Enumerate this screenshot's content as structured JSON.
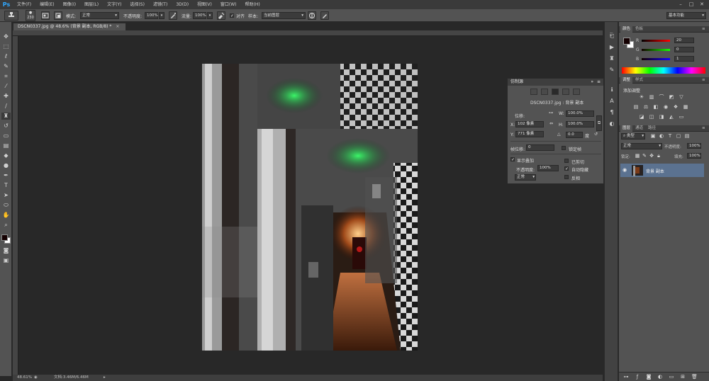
{
  "app": {
    "logo": "Ps"
  },
  "menubar": {
    "items": [
      "文件(F)",
      "编辑(E)",
      "图像(I)",
      "图层(L)",
      "文字(Y)",
      "选择(S)",
      "滤镜(T)",
      "3D(D)",
      "视图(V)",
      "窗口(W)",
      "帮助(H)"
    ],
    "window_controls": [
      "minimize-icon",
      "maximize-icon",
      "close-icon"
    ]
  },
  "options": {
    "brush_size": "230",
    "mode_label": "模式:",
    "mode_value": "正常",
    "opacity_label": "不透明度:",
    "opacity_value": "100%",
    "flow_label": "流量:",
    "flow_value": "100%",
    "align_label": "对齐",
    "sample_label": "样本:",
    "sample_value": "当前图层",
    "workspace": "基本功能"
  },
  "document": {
    "tab_title": "DSCN0337.jpg @ 48.6% (背景 副本, RGB/8) *",
    "zoom": "48.61%",
    "doc_info": "文档:3.46M/6.46M"
  },
  "clone_source": {
    "title": "仿制源",
    "source_name": "DSCN0337.jpg : 背景 副本",
    "offset_label": "位移:",
    "x_label": "X:",
    "x_value": "102 像素",
    "y_label": "Y:",
    "y_value": "771 像素",
    "w_label": "W:",
    "w_value": "100.0%",
    "h_label": "H:",
    "h_value": "100.0%",
    "angle_value": "0.0",
    "angle_unit": "度",
    "frame_offset_label": "帧位移:",
    "frame_offset_value": "0",
    "lock_frame_label": "锁定帧",
    "show_overlay_label": "显示叠加",
    "show_overlay_checked": true,
    "opacity_label": "不透明度:",
    "opacity_value": "100%",
    "clipped_label": "已剪切",
    "clipped_checked": false,
    "auto_hide_label": "自动隐藏",
    "auto_hide_checked": true,
    "invert_label": "反相",
    "invert_checked": false,
    "blend_value": "正常"
  },
  "color_panel": {
    "tabs": [
      "颜色",
      "色板"
    ],
    "r_label": "R",
    "r_value": "20",
    "g_label": "G",
    "g_value": "0",
    "b_label": "B",
    "b_value": "1",
    "foreground": "#140001",
    "background": "#ffffff"
  },
  "adjustments_panel": {
    "tabs": [
      "调整",
      "样式"
    ],
    "heading": "添加调整"
  },
  "layers_panel": {
    "tabs": [
      "图层",
      "通道",
      "路径"
    ],
    "kind_value": "类型",
    "blend_value": "正常",
    "opacity_label": "不透明度:",
    "opacity_value": "100%",
    "lock_label": "锁定:",
    "fill_label": "填充:",
    "fill_value": "100%",
    "layers": [
      {
        "name": "背景 副本",
        "visible": true,
        "selected": true
      }
    ]
  },
  "colors": {
    "accent": "#31a8ff",
    "selected_layer": "#5b7290",
    "panel_bg": "#535353",
    "canvas_bg": "#282828"
  }
}
